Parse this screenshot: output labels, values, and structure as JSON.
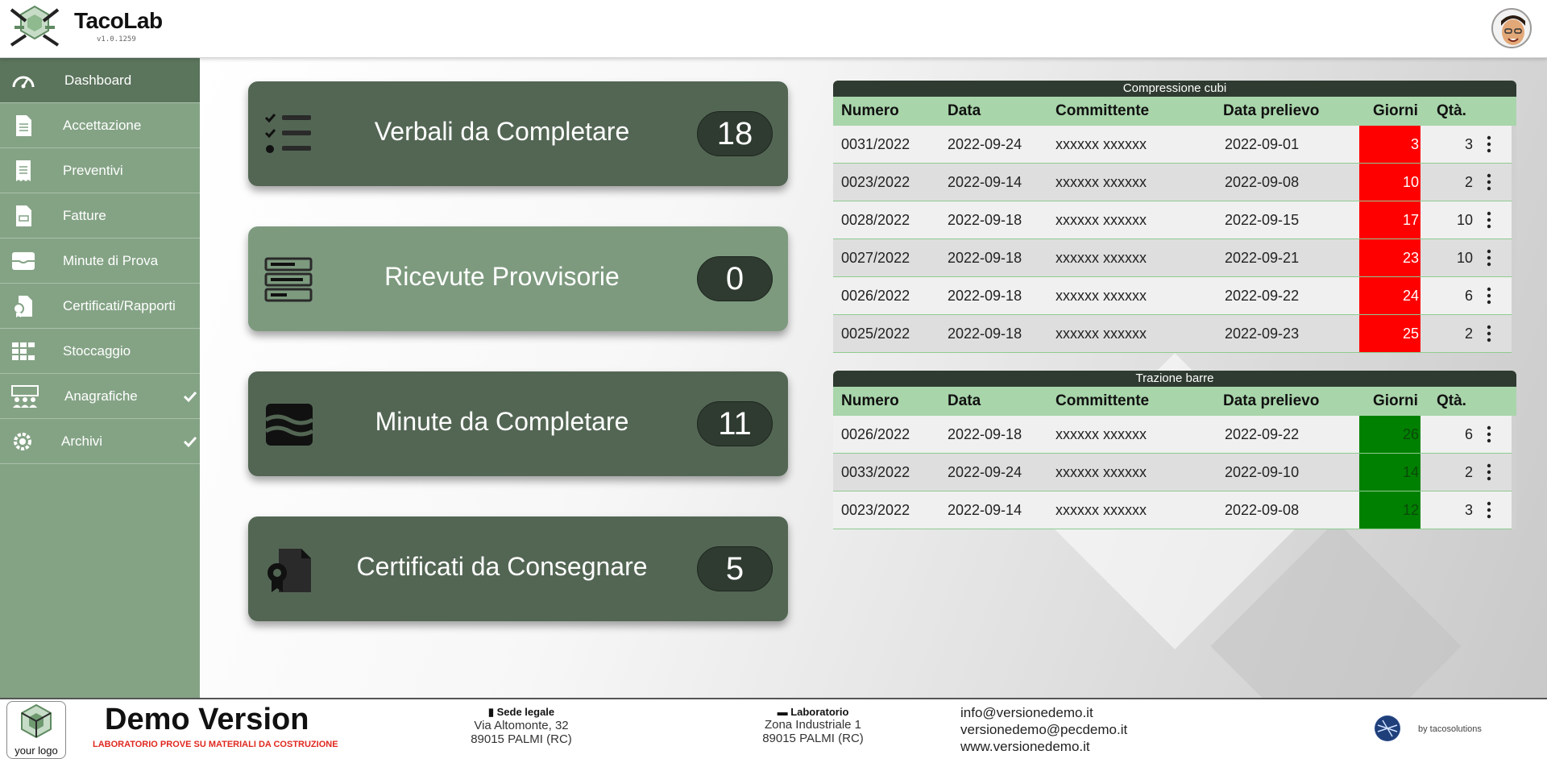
{
  "header": {
    "brand": "TacoLab",
    "version": "v1.0.1259"
  },
  "sidebar": {
    "items": [
      {
        "label": "Dashboard",
        "icon": "gauge-icon"
      },
      {
        "label": "Accettazione",
        "icon": "document-list-icon"
      },
      {
        "label": "Preventivi",
        "icon": "receipt-icon"
      },
      {
        "label": "Fatture",
        "icon": "invoice-icon"
      },
      {
        "label": "Minute di Prova",
        "icon": "inbox-tray-icon"
      },
      {
        "label": "Certificati/Rapporti",
        "icon": "certificate-icon"
      },
      {
        "label": "Stoccaggio",
        "icon": "grid-storage-icon"
      },
      {
        "label": "Anagrafiche",
        "icon": "users-icon"
      },
      {
        "label": "Archivi",
        "icon": "archive-gear-icon"
      }
    ]
  },
  "cards": [
    {
      "title": "Verbali da Completare",
      "count": "18",
      "icon": "checklist-icon"
    },
    {
      "title": "Ricevute Provvisorie",
      "count": "0",
      "icon": "receipt-lines-icon"
    },
    {
      "title": "Minute da Completare",
      "count": "11",
      "icon": "tray-wave-icon"
    },
    {
      "title": "Certificati da Consegnare",
      "count": "5",
      "icon": "certificate-doc-icon"
    }
  ],
  "tables": {
    "compressione": {
      "caption": "Compressione cubi",
      "headers": {
        "numero": "Numero",
        "data": "Data",
        "committente": "Committente",
        "data_prelievo": "Data prelievo",
        "giorni": "Giorni",
        "qta": "Qtà."
      },
      "rows": [
        {
          "numero": "0031/2022",
          "data": "2022-09-24",
          "committente": "xxxxxx xxxxxx",
          "data_prelievo": "2022-09-01",
          "giorni": "3",
          "qta": "3"
        },
        {
          "numero": "0023/2022",
          "data": "2022-09-14",
          "committente": "xxxxxx xxxxxx",
          "data_prelievo": "2022-09-08",
          "giorni": "10",
          "qta": "2"
        },
        {
          "numero": "0028/2022",
          "data": "2022-09-18",
          "committente": "xxxxxx xxxxxx",
          "data_prelievo": "2022-09-15",
          "giorni": "17",
          "qta": "10"
        },
        {
          "numero": "0027/2022",
          "data": "2022-09-18",
          "committente": "xxxxxx xxxxxx",
          "data_prelievo": "2022-09-21",
          "giorni": "23",
          "qta": "10"
        },
        {
          "numero": "0026/2022",
          "data": "2022-09-18",
          "committente": "xxxxxx xxxxxx",
          "data_prelievo": "2022-09-22",
          "giorni": "24",
          "qta": "6"
        },
        {
          "numero": "0025/2022",
          "data": "2022-09-18",
          "committente": "xxxxxx xxxxxx",
          "data_prelievo": "2022-09-23",
          "giorni": "25",
          "qta": "2"
        }
      ]
    },
    "trazione": {
      "caption": "Trazione barre",
      "headers": {
        "numero": "Numero",
        "data": "Data",
        "committente": "Committente",
        "data_prelievo": "Data prelievo",
        "giorni": "Giorni",
        "qta": "Qtà."
      },
      "rows": [
        {
          "numero": "0026/2022",
          "data": "2022-09-18",
          "committente": "xxxxxx xxxxxx",
          "data_prelievo": "2022-09-22",
          "giorni": "26",
          "qta": "6"
        },
        {
          "numero": "0033/2022",
          "data": "2022-09-24",
          "committente": "xxxxxx xxxxxx",
          "data_prelievo": "2022-09-10",
          "giorni": "14",
          "qta": "2"
        },
        {
          "numero": "0023/2022",
          "data": "2022-09-14",
          "committente": "xxxxxx xxxxxx",
          "data_prelievo": "2022-09-08",
          "giorni": "12",
          "qta": "3"
        }
      ]
    }
  },
  "footer": {
    "logo_text": "your logo",
    "title": "Demo Version",
    "subtitle": "LABORATORIO PROVE SU MATERIALI DA COSTRUZIONE",
    "sede": {
      "heading": "Sede legale",
      "line1": "Via Altomonte, 32",
      "line2": "89015 PALMI (RC)"
    },
    "laboratorio": {
      "heading": "Laboratorio",
      "line1": "Zona Industriale 1",
      "line2": "89015 PALMI (RC)"
    },
    "contacts": [
      "info@versionedemo.it",
      "versionedemo@pecdemo.it",
      "www.versionedemo.it"
    ],
    "credit": "by tacosolutions"
  },
  "colors": {
    "sidebar": "#84a385",
    "sidebar_active": "#5b745c",
    "card_dark": "#536654",
    "card_light": "#7d9a7e",
    "table_header": "#a8d5aa",
    "overdue": "#ff0000",
    "ok": "#008000",
    "footer_subtitle": "#e0281f"
  }
}
